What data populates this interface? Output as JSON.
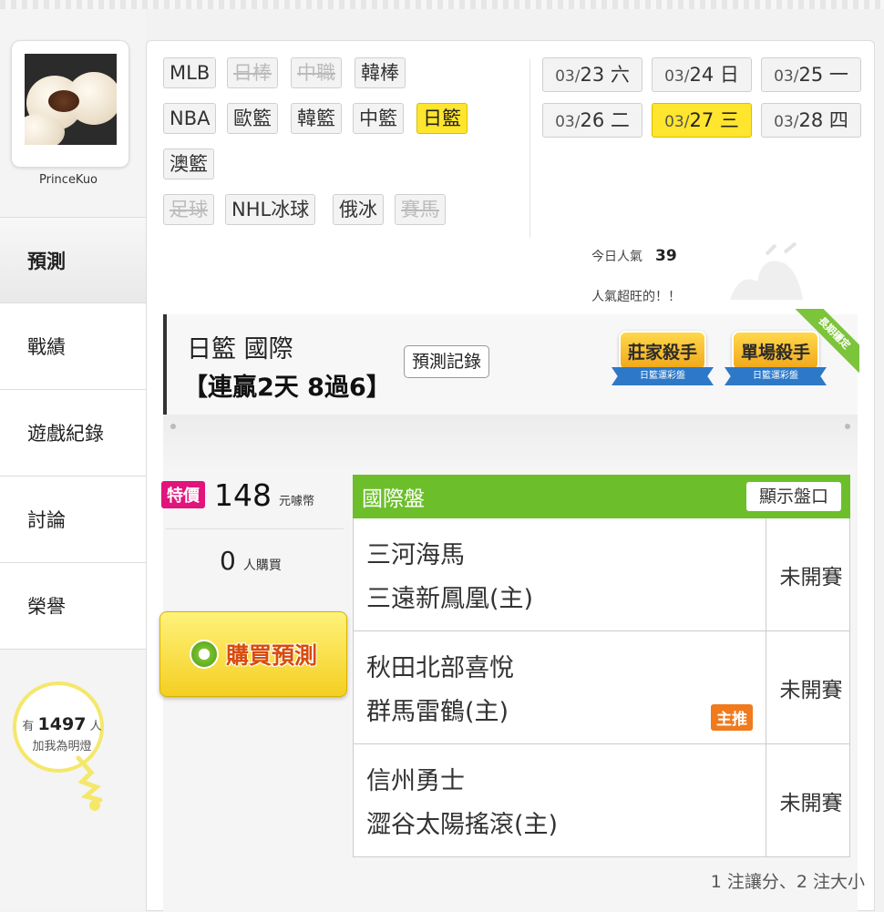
{
  "user": {
    "name": "PrinceKuo"
  },
  "menu": [
    {
      "label": "預測",
      "active": true
    },
    {
      "label": "戰績"
    },
    {
      "label": "遊戲紀錄"
    },
    {
      "label": "討論"
    },
    {
      "label": "榮譽"
    }
  ],
  "fans": {
    "prefix": "有",
    "count": "1497",
    "suffix": "人",
    "line2": "加我為明燈"
  },
  "leagues": {
    "row1": [
      {
        "label": "MLB",
        "state": "on"
      },
      {
        "label": "日棒",
        "state": "off"
      },
      {
        "label": "中職",
        "state": "off"
      },
      {
        "label": "韓棒",
        "state": "on"
      }
    ],
    "row2": [
      {
        "label": "NBA",
        "state": "on"
      },
      {
        "label": "歐籃",
        "state": "on"
      },
      {
        "label": "韓籃",
        "state": "on"
      },
      {
        "label": "中籃",
        "state": "on"
      },
      {
        "label": "日籃",
        "state": "selected"
      }
    ],
    "row3": [
      {
        "label": "澳籃",
        "state": "on"
      }
    ],
    "row4": [
      {
        "label": "足球",
        "state": "off"
      },
      {
        "label": "NHL冰球",
        "state": "on"
      },
      {
        "label": "俄冰",
        "state": "on"
      },
      {
        "label": "賽馬",
        "state": "off"
      }
    ]
  },
  "dates": [
    {
      "md": "03/",
      "d": "23",
      "dow": "六"
    },
    {
      "md": "03/",
      "d": "24",
      "dow": "日"
    },
    {
      "md": "03/",
      "d": "25",
      "dow": "一"
    },
    {
      "md": "03/",
      "d": "26",
      "dow": "二"
    },
    {
      "md": "03/",
      "d": "27",
      "dow": "三",
      "selected": true
    },
    {
      "md": "03/",
      "d": "28",
      "dow": "四"
    }
  ],
  "popularity": {
    "label": "今日人氣",
    "value": "39",
    "note": "人氣超旺的！！"
  },
  "header": {
    "title": "日籃 國際",
    "streak": "【連贏2天 8過6】",
    "record_button": "預測記錄",
    "badges": [
      {
        "title": "莊家殺手",
        "sub": "日籃運彩盤"
      },
      {
        "title": "單場殺手",
        "sub": "日籃運彩盤"
      }
    ],
    "corner": "長期穩定"
  },
  "purchase": {
    "special": "特價",
    "price": "148",
    "price_unit": "元噱幣",
    "buyers": "0",
    "buyers_unit": "人購買",
    "button": "購買預測"
  },
  "odds": {
    "title": "國際盤",
    "show_button": "顯示盤口",
    "games": [
      {
        "away": "三河海馬",
        "home": "三遠新鳳凰(主)",
        "status": "未開賽"
      },
      {
        "away": "秋田北部喜悅",
        "home": "群馬雷鶴(主)",
        "status": "未開賽",
        "tag": "主推"
      },
      {
        "away": "信州勇士",
        "home": "澀谷太陽搖滾(主)",
        "status": "未開賽"
      }
    ],
    "footer": "1 注讓分、2 注大小"
  },
  "colors": {
    "accent_yellow": "#ffe52d",
    "odds_green": "#6cbf2a",
    "special_pink": "#e2137b",
    "tag_orange": "#f07a1c"
  }
}
